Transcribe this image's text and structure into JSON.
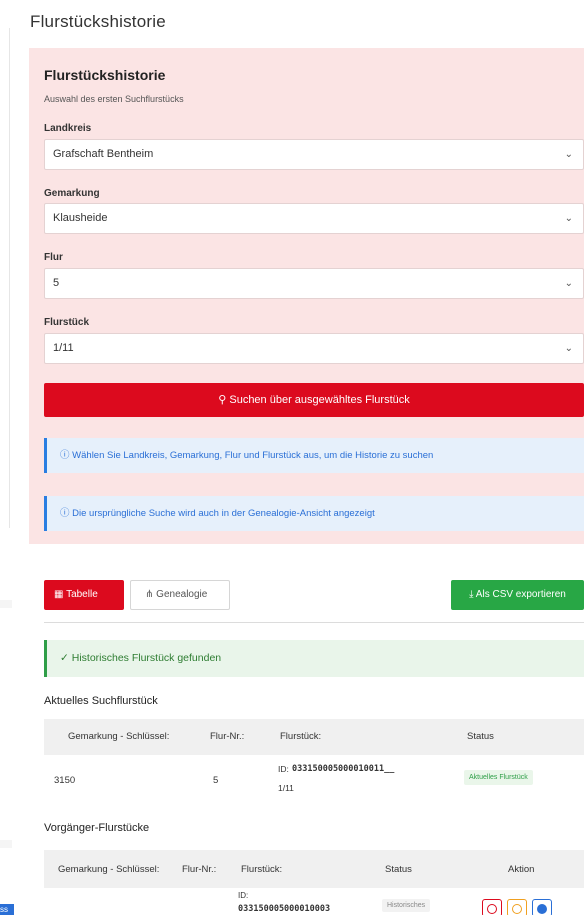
{
  "page": {
    "title": "Flurstückshistorie"
  },
  "search_card": {
    "title": "Flurstückshistorie",
    "subtitle": "Auswahl des ersten Suchflurstücks",
    "fields": [
      {
        "label": "Landkreis",
        "value": "Grafschaft Bentheim"
      },
      {
        "label": "Gemarkung",
        "value": "Klausheide"
      },
      {
        "label": "Flur",
        "value": "5"
      },
      {
        "label": "Flurstück",
        "value": "1/11"
      }
    ],
    "search_button": "Suchen über ausgewähltes Flurstück",
    "info": [
      "Wählen Sie Landkreis, Gemarkung, Flur und Flurstück aus, um die Historie zu suchen",
      "Die ursprüngliche Suche wird auch in der Genealogie-Ansicht angezeigt"
    ]
  },
  "view_tabs": [
    {
      "label": "Tabelle",
      "icon": "table-icon",
      "active": true
    },
    {
      "label": "Genealogie",
      "icon": "genealogy-icon",
      "active": false
    }
  ],
  "export_button": "Als CSV exportieren",
  "success_alert": "Historisches Flurstück gefunden",
  "current": {
    "heading": "Aktuelles Suchflurstück",
    "columns": [
      "Gemarkung - Schlüssel:",
      "Flur-Nr.:",
      "Flurstück:",
      "Status"
    ],
    "row": {
      "gemarkung": "3150",
      "flur": "5",
      "id_label": "ID:",
      "id": "033150005000010011__",
      "flurstueck": "1/11",
      "status": "Aktuelles Flurstück"
    }
  },
  "predecessors": {
    "heading": "Vorgänger-Flurstücke",
    "columns": [
      "Gemarkung - Schlüssel:",
      "Flur-Nr.:",
      "Flurstück:",
      "Status",
      "Aktion"
    ],
    "row": {
      "id_label": "ID:",
      "id": "033150005000010003",
      "status": "Historisches"
    }
  },
  "colors": {
    "primary_red": "#dc0a1e",
    "success_green": "#28a745",
    "info_blue": "#2a7de1",
    "card_pink": "#fbe4e4"
  }
}
